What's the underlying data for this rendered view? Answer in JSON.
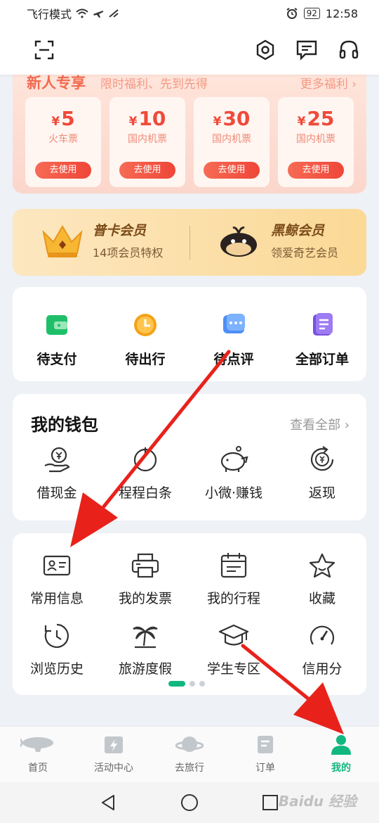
{
  "statusbar": {
    "left": "飞行模式",
    "battery": "92",
    "time": "12:58"
  },
  "promo": {
    "title": "新人专享",
    "subtitle": "限时福利、先到先得",
    "more": "更多福利 ›",
    "coupons": [
      {
        "currency": "¥",
        "amount": "5",
        "name": "火车票",
        "button": "去使用"
      },
      {
        "currency": "¥",
        "amount": "10",
        "name": "国内机票",
        "button": "去使用"
      },
      {
        "currency": "¥",
        "amount": "30",
        "name": "国内机票",
        "button": "去使用"
      },
      {
        "currency": "¥",
        "amount": "25",
        "name": "国内机票",
        "button": "去使用"
      }
    ]
  },
  "membership": [
    {
      "title": "普卡会员",
      "subtitle": "14项会员特权"
    },
    {
      "title": "黑鲸会员",
      "subtitle": "领爱奇艺会员"
    }
  ],
  "orders": [
    {
      "label": "待支付",
      "icon": "wallet-icon"
    },
    {
      "label": "待出行",
      "icon": "clock-icon"
    },
    {
      "label": "待点评",
      "icon": "chat-icon"
    },
    {
      "label": "全部订单",
      "icon": "document-icon"
    }
  ],
  "wallet": {
    "title": "我的钱包",
    "more": "查看全部 ›",
    "items": [
      {
        "label": "借现金",
        "icon": "cash-hand-icon"
      },
      {
        "label": "程程白条",
        "icon": "credit-icon"
      },
      {
        "label": "小微·赚钱",
        "icon": "piggy-bank-icon"
      },
      {
        "label": "返现",
        "icon": "cashback-icon"
      }
    ]
  },
  "tools": [
    {
      "label": "常用信息",
      "icon": "id-card-icon"
    },
    {
      "label": "我的发票",
      "icon": "printer-icon"
    },
    {
      "label": "我的行程",
      "icon": "calendar-icon"
    },
    {
      "label": "收藏",
      "icon": "star-icon"
    },
    {
      "label": "浏览历史",
      "icon": "history-icon"
    },
    {
      "label": "旅游度假",
      "icon": "palm-tree-icon"
    },
    {
      "label": "学生专区",
      "icon": "graduation-cap-icon"
    },
    {
      "label": "信用分",
      "icon": "gauge-icon"
    }
  ],
  "tabs": [
    {
      "label": "首页",
      "icon": "airship-icon",
      "active": false
    },
    {
      "label": "活动中心",
      "icon": "lightning-calendar-icon",
      "active": false
    },
    {
      "label": "去旅行",
      "icon": "planet-icon",
      "active": false
    },
    {
      "label": "订单",
      "icon": "order-icon",
      "active": false
    },
    {
      "label": "我的",
      "icon": "user-icon",
      "active": true
    }
  ],
  "watermark": "Baidu 经验",
  "colors": {
    "accent": "#11b77f",
    "promo_red": "#ef4a3a",
    "arrow": "#e8221b"
  }
}
